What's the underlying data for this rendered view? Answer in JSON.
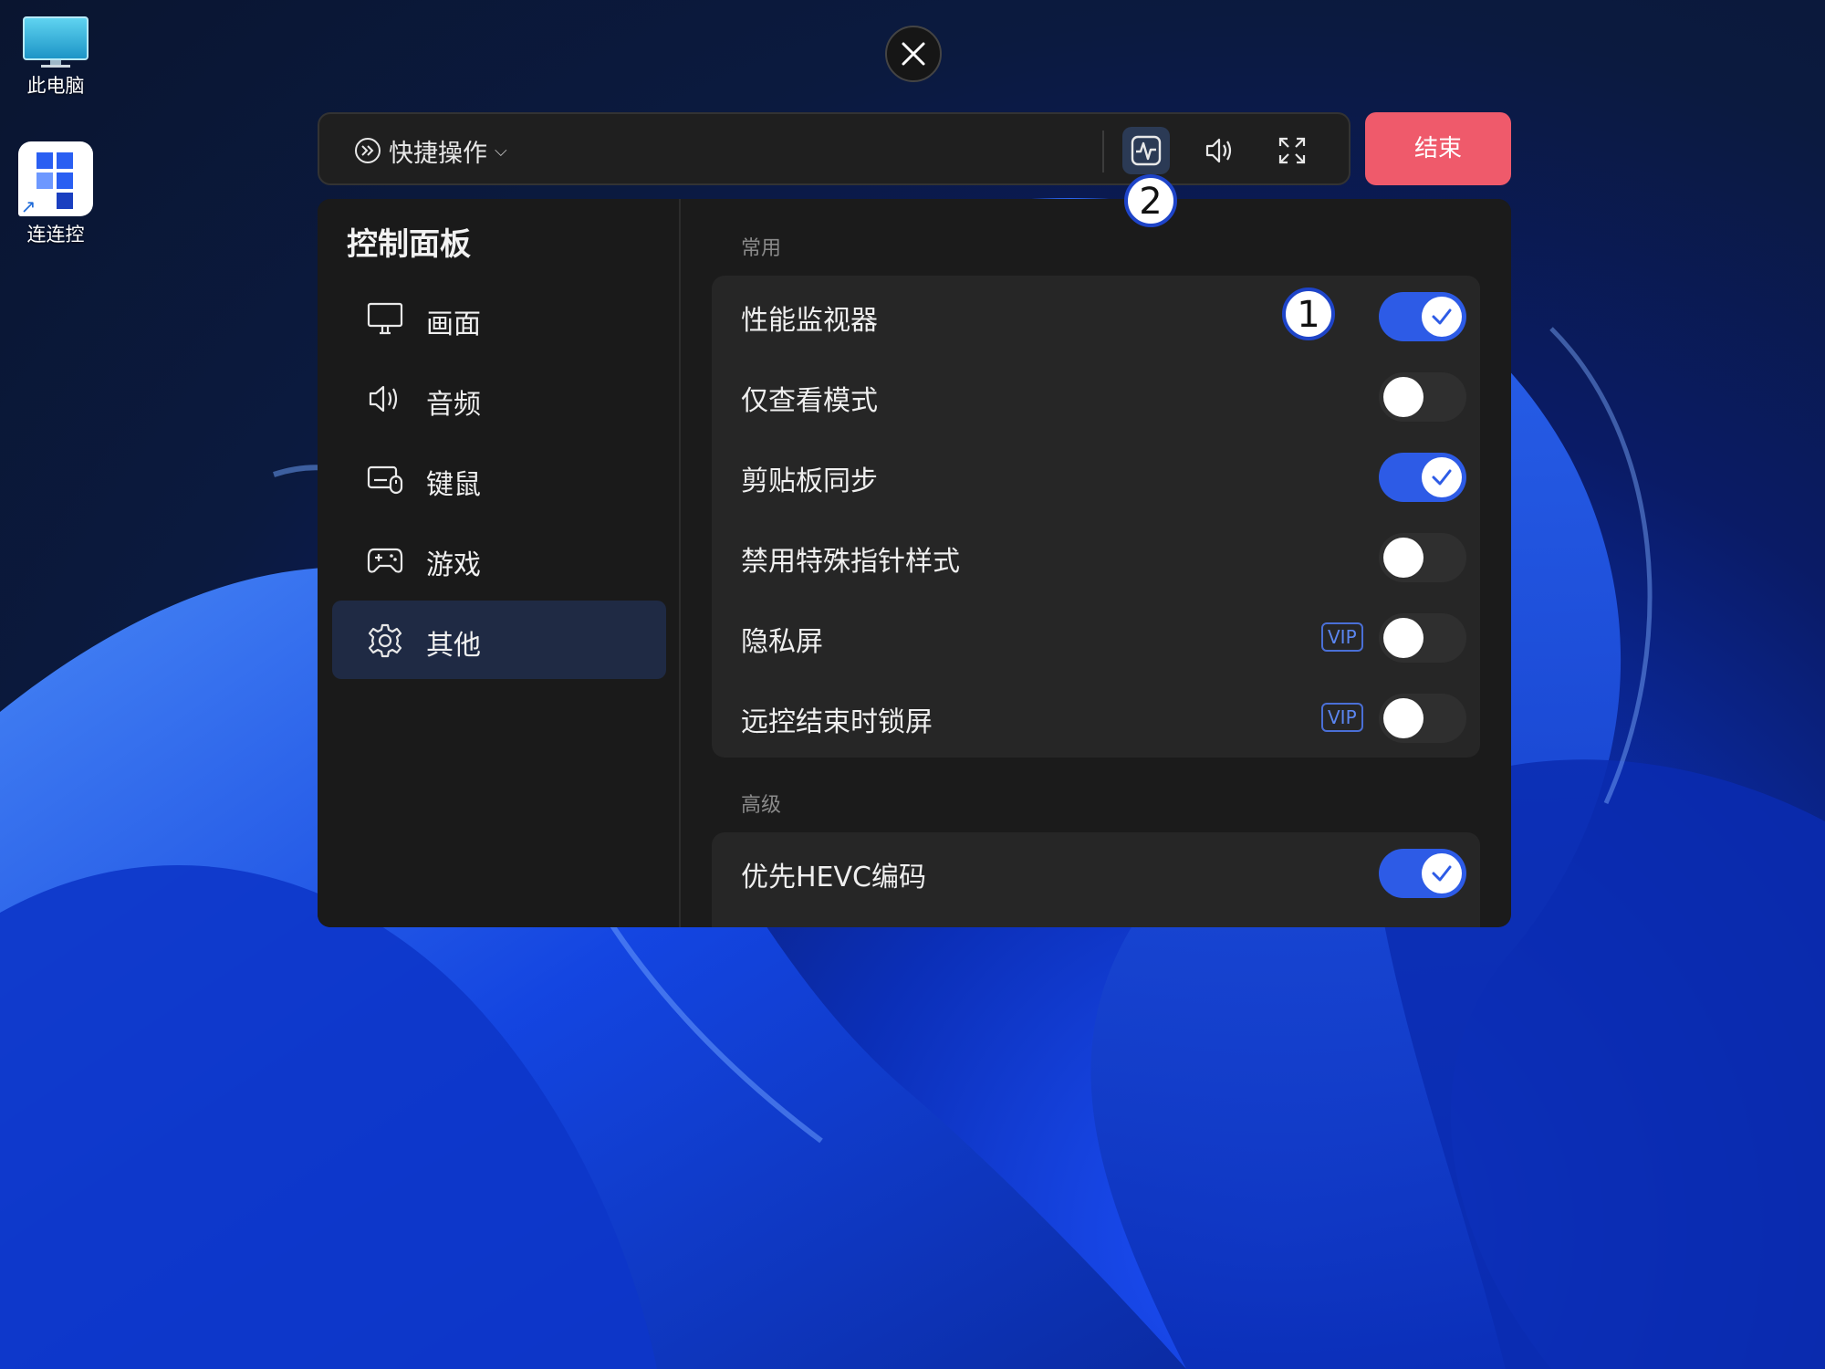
{
  "desktop": {
    "icons": [
      {
        "label": "此电脑"
      },
      {
        "label": "连连控"
      }
    ]
  },
  "toolbar": {
    "quick_label": "快捷操作",
    "end_label": "结束"
  },
  "panel": {
    "title": "控制面板",
    "nav": [
      {
        "label": "画面",
        "icon": "monitor-icon"
      },
      {
        "label": "音频",
        "icon": "speaker-icon"
      },
      {
        "label": "键鼠",
        "icon": "keyboard-mouse-icon"
      },
      {
        "label": "游戏",
        "icon": "gamepad-icon"
      },
      {
        "label": "其他",
        "icon": "gear-icon",
        "active": true
      }
    ],
    "sections": [
      {
        "label": "常用",
        "rows": [
          {
            "name": "性能监视器",
            "on": true
          },
          {
            "name": "仅查看模式",
            "on": false
          },
          {
            "name": "剪贴板同步",
            "on": true
          },
          {
            "name": "禁用特殊指针样式",
            "on": false
          },
          {
            "name": "隐私屏",
            "on": false,
            "badge": "VIP"
          },
          {
            "name": "远控结束时锁屏",
            "on": false,
            "badge": "VIP"
          }
        ]
      },
      {
        "label": "高级",
        "rows": [
          {
            "name": "优先HEVC编码",
            "on": true
          }
        ]
      }
    ]
  },
  "markers": [
    "1",
    "2"
  ],
  "colors": {
    "accent": "#2d5be6",
    "end_button": "#ef5a6b",
    "panel_bg": "#1b1b1b",
    "vip": "#5b86f0"
  }
}
